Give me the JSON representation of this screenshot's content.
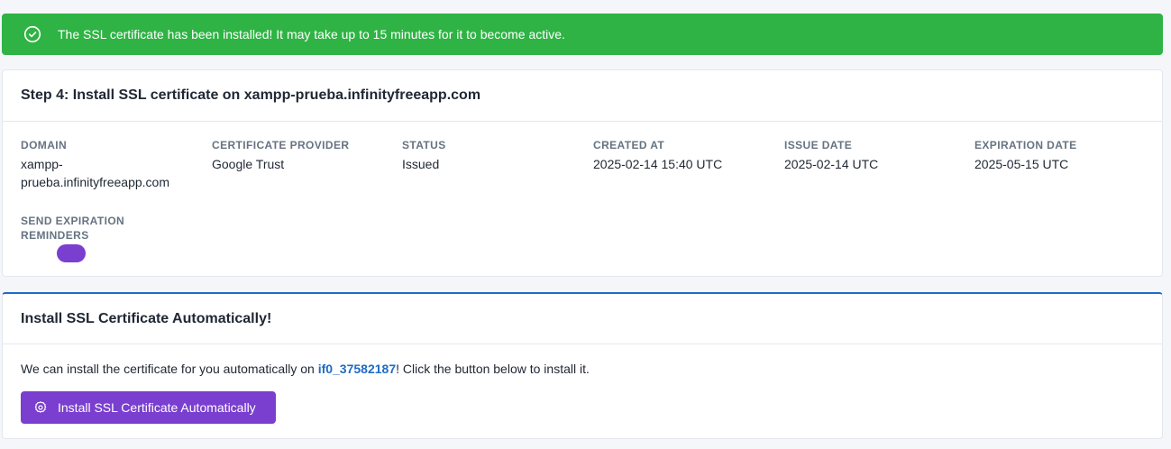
{
  "alert": {
    "message": "The SSL certificate has been installed! It may take up to 15 minutes for it to become active.",
    "icon": "check-circle-icon",
    "color": "#2fb344"
  },
  "certificate_card": {
    "title": "Step 4: Install SSL certificate on xampp-prueba.infinityfreeapp.com",
    "fields": {
      "domain": {
        "label": "DOMAIN",
        "value_line1": "xampp-",
        "value_line2": "prueba.infinityfreeapp.com"
      },
      "provider": {
        "label": "CERTIFICATE PROVIDER",
        "value": "Google Trust"
      },
      "status": {
        "label": "STATUS",
        "value": "Issued"
      },
      "created_at": {
        "label": "CREATED AT",
        "value": "2025-02-14 15:40 UTC"
      },
      "issue_date": {
        "label": "ISSUE DATE",
        "value": "2025-02-14 UTC"
      },
      "expiration_date": {
        "label": "EXPIRATION DATE",
        "value": "2025-05-15 UTC"
      }
    },
    "reminders": {
      "label_line1": "SEND EXPIRATION",
      "label_line2": "REMINDERS",
      "enabled": true,
      "toggle_color": "#7a3fcf"
    }
  },
  "install_card": {
    "title": "Install SSL Certificate Automatically!",
    "text_before": "We can install the certificate for you automatically on ",
    "account_link": "if0_37582187",
    "text_after": "! Click the button below to install it.",
    "button_label": "Install SSL Certificate Automatically",
    "button_icon": "gear-icon",
    "accent_color": "#206bc4"
  }
}
